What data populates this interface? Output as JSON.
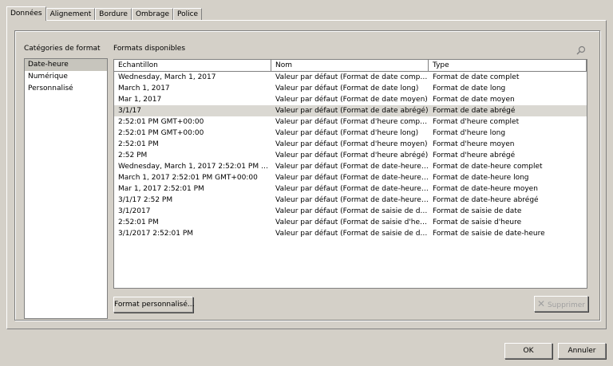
{
  "tabs": [
    "Données",
    "Alignement",
    "Bordure",
    "Ombrage",
    "Police"
  ],
  "categories_label": "Catégories de format",
  "formats_label": "Formats disponibles",
  "categories": [
    "Date-heure",
    "Numérique",
    "Personnalisé"
  ],
  "columns": [
    "Echantillon",
    "Nom",
    "Type"
  ],
  "rows": [
    [
      "Wednesday, March 1, 2017",
      "Valeur par défaut (Format de date complet)",
      "Format de date complet"
    ],
    [
      "March 1, 2017",
      "Valeur par défaut (Format de date long)",
      "Format de date long"
    ],
    [
      "Mar 1, 2017",
      "Valeur par défaut (Format de date moyen)",
      "Format de date moyen"
    ],
    [
      "3/1/17",
      "Valeur par défaut (Format de date abrégé)",
      "Format de date abrégé"
    ],
    [
      "2:52:01 PM GMT+00:00",
      "Valeur par défaut (Format d'heure complet)",
      "Format d'heure complet"
    ],
    [
      "2:52:01 PM GMT+00:00",
      "Valeur par défaut (Format d'heure long)",
      "Format d'heure long"
    ],
    [
      "2:52:01 PM",
      "Valeur par défaut (Format d'heure moyen)",
      "Format d'heure moyen"
    ],
    [
      "2:52 PM",
      "Valeur par défaut (Format d'heure abrégé)",
      "Format d'heure abrégé"
    ],
    [
      "Wednesday, March 1, 2017 2:52:01 PM GMT...",
      "Valeur par défaut (Format de date-heure co...",
      "Format de date-heure complet"
    ],
    [
      "March 1, 2017 2:52:01 PM GMT+00:00",
      "Valeur par défaut (Format de date-heure long)",
      "Format de date-heure long"
    ],
    [
      "Mar 1, 2017 2:52:01 PM",
      "Valeur par défaut (Format de date-heure mo...",
      "Format de date-heure moyen"
    ],
    [
      "3/1/17 2:52 PM",
      "Valeur par défaut (Format de date-heure abr...",
      "Format de date-heure abrégé"
    ],
    [
      "3/1/2017",
      "Valeur par défaut (Format de saisie de date)",
      "Format de saisie de date"
    ],
    [
      "2:52:01 PM",
      "Valeur par défaut (Format de saisie d'heure)",
      "Format de saisie d'heure"
    ],
    [
      "3/1/2017 2:52:01 PM",
      "Valeur par défaut (Format de saisie de date-...",
      "Format de saisie de date-heure"
    ]
  ],
  "buttons": {
    "custom": "Format personnalisé...",
    "delete": "Supprimer",
    "ok": "OK",
    "cancel": "Annuler"
  },
  "icons": {
    "search": "search-icon",
    "delete": "x-icon"
  }
}
